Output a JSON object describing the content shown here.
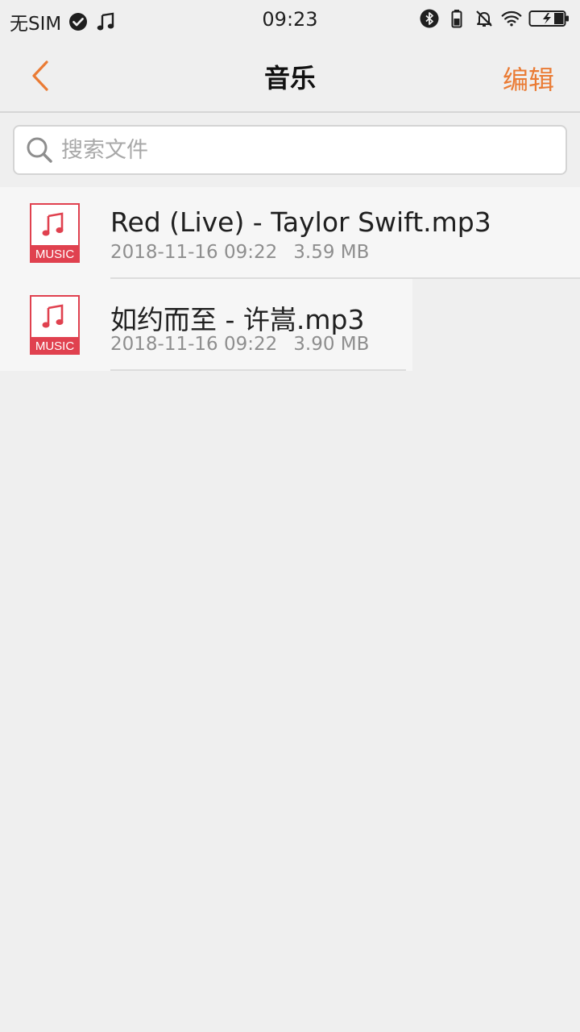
{
  "status_bar": {
    "carrier": "无SIM",
    "time": "09:23",
    "icons_left": [
      "check-circle-icon",
      "music-note-icon"
    ],
    "icons_right": [
      "bluetooth-icon",
      "battery-small-icon",
      "mute-bell-icon",
      "wifi-icon",
      "battery-charging-icon"
    ]
  },
  "header": {
    "title": "音乐",
    "edit_label": "编辑",
    "accent_color": "#ea7b34"
  },
  "search": {
    "placeholder": "搜索文件"
  },
  "files": [
    {
      "name": "Red (Live) - Taylor Swift.mp3",
      "date": "2018-11-16 09:22",
      "size": "3.59 MB",
      "icon_label": "MUSIC"
    },
    {
      "name": "如约而至 - 许嵩.mp3",
      "date": "2018-11-16 09:22",
      "size": "3.90 MB",
      "icon_label": "MUSIC"
    }
  ]
}
